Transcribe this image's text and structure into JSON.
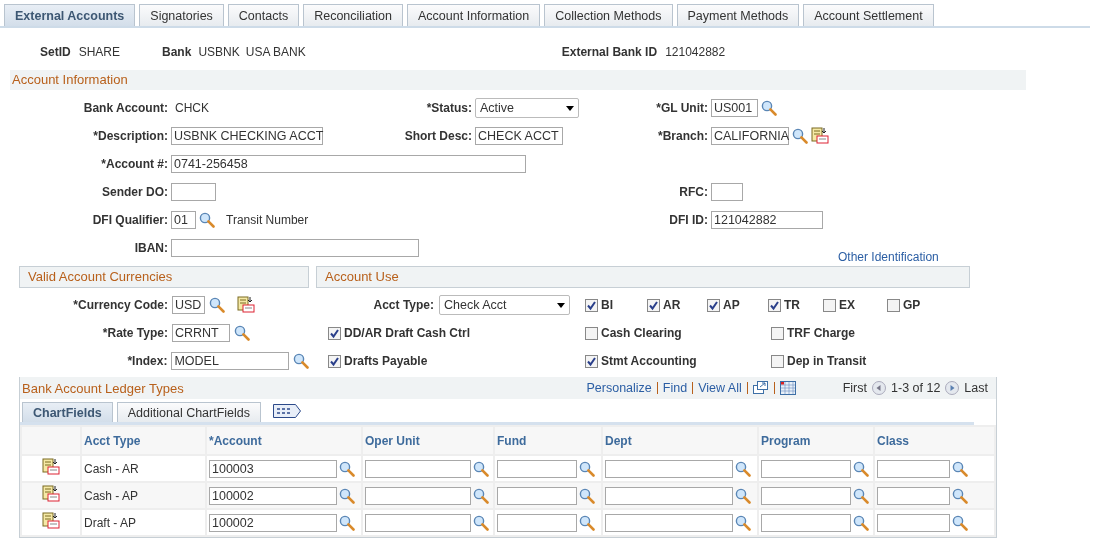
{
  "tabs": [
    {
      "label": "External Accounts",
      "selected": true
    },
    {
      "label": "Signatories",
      "selected": false
    },
    {
      "label": "Contacts",
      "selected": false
    },
    {
      "label": "Reconciliation",
      "selected": false
    },
    {
      "label": "Account Information",
      "selected": false
    },
    {
      "label": "Collection Methods",
      "selected": false
    },
    {
      "label": "Payment Methods",
      "selected": false
    },
    {
      "label": "Account Settlement",
      "selected": false
    }
  ],
  "header": {
    "setid_label": "SetID",
    "setid": "SHARE",
    "bank_label": "Bank",
    "bank_code": "USBNK",
    "bank_name": "USA BANK",
    "external_bank_id_label": "External Bank ID",
    "external_bank_id": "121042882"
  },
  "account_information": {
    "title": "Account Information",
    "bank_account": {
      "label": "Bank Account:",
      "value": "CHCK"
    },
    "status": {
      "label": "*Status:",
      "value": "Active"
    },
    "gl_unit": {
      "label": "*GL Unit:",
      "value": "US001"
    },
    "description": {
      "label": "*Description:",
      "value": "USBNK CHECKING ACCT"
    },
    "short_desc": {
      "label": "Short Desc:",
      "value": "CHECK ACCT"
    },
    "branch": {
      "label": "*Branch:",
      "value": "CALIFORNIA"
    },
    "account_number": {
      "label": "*Account #:",
      "value": "0741-256458"
    },
    "sender_do": {
      "label": "Sender DO:"
    },
    "rfc": {
      "label": "RFC:"
    },
    "dfi_qualifier": {
      "label": "DFI Qualifier:",
      "value": "01",
      "description": "Transit Number"
    },
    "dfi_id": {
      "label": "DFI ID:",
      "value": "121042882"
    },
    "iban": {
      "label": "IBAN:"
    },
    "other_identification": "Other Identification"
  },
  "currencies": {
    "title": "Valid Account Currencies",
    "currency_code": {
      "label": "*Currency Code:",
      "value": "USD"
    },
    "rate_type": {
      "label": "*Rate Type:",
      "value": "CRRNT"
    },
    "index": {
      "label": "*Index:",
      "value": "MODEL"
    }
  },
  "account_use": {
    "title": "Account Use",
    "acct_type": {
      "label": "Acct Type:",
      "value": "Check Acct"
    },
    "types": [
      {
        "label": "BI",
        "checked": true
      },
      {
        "label": "AR",
        "checked": true
      },
      {
        "label": "AP",
        "checked": true
      },
      {
        "label": "TR",
        "checked": true
      },
      {
        "label": "EX",
        "checked": false
      },
      {
        "label": "GP",
        "checked": false
      }
    ],
    "options": [
      {
        "label": "DD/AR Draft Cash Ctrl",
        "checked": true
      },
      {
        "label": "Cash Clearing",
        "checked": false
      },
      {
        "label": "TRF Charge",
        "checked": false
      },
      {
        "label": "Drafts Payable",
        "checked": true
      },
      {
        "label": "Stmt Accounting",
        "checked": true
      },
      {
        "label": "Dep in Transit",
        "checked": false
      }
    ]
  },
  "ledger_grid": {
    "title": "Bank Account Ledger Types",
    "links": [
      "Personalize",
      "Find",
      "View All"
    ],
    "first": "First",
    "range": "1-3 of 12",
    "last": "Last",
    "tabs": [
      {
        "label": "ChartFields",
        "selected": true
      },
      {
        "label": "Additional ChartFields",
        "selected": false
      }
    ],
    "columns": [
      "Acct Type",
      "*Account",
      "Oper Unit",
      "Fund",
      "Dept",
      "Program",
      "Class"
    ],
    "rows": [
      {
        "acct_type": "Cash - AR",
        "account": "100003"
      },
      {
        "acct_type": "Cash - AP",
        "account": "100002"
      },
      {
        "acct_type": "Draft - AP",
        "account": "100002"
      }
    ]
  }
}
